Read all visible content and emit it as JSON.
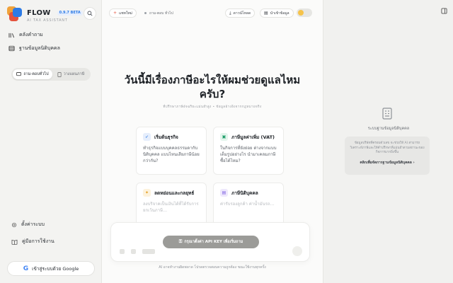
{
  "brand": {
    "name": "FLOW",
    "version": "0.9.7 BETA",
    "subtitle": "AI TAX ASSISTANT"
  },
  "sidebar": {
    "nav": [
      {
        "label": "คลังคำถาม",
        "icon": "library-icon"
      },
      {
        "label": "ฐานข้อมูลนิติบุคคล",
        "icon": "database-icon"
      }
    ],
    "segments": [
      {
        "label": "ถาม-ตอบทั่วไป",
        "icon": "chat-icon",
        "active": true
      },
      {
        "label": "วางแผนภาษี",
        "icon": "document-icon",
        "active": false
      }
    ],
    "settings_label": "ตั้งค่าระบบ",
    "guide_label": "คู่มือการใช้งาน",
    "google_login_label": "เข้าสู่ระบบด้วย Google"
  },
  "topbar": {
    "new_chat_label": "แชทใหม่",
    "mode_label": "ถาม-ตอบ ทั่วไป",
    "download_label": "ดาวน์โหลด",
    "company_label": "นำเข้าข้อมูล"
  },
  "main": {
    "headline": "วันนี้มีเรื่องภาษีอะไรให้ผมช่วยดูแลไหมครับ?",
    "subline": "ที่ปรึกษาภาษีอัจฉริยะแม่นยำสูง • ข้อมูลอ้างอิงจากกฎหมายจริง"
  },
  "cards": [
    {
      "title": "เริ่มต้นธุรกิจ",
      "desc": "ทำธุรกิจแบบบุคคลธรรมดากับ นิติบุคคล แบบไหนเสียภาษีน้อยกว่ากัน?",
      "icon": "rocket-icon",
      "icon_color": "#2d7be5",
      "icon_bg": "#e6eefc",
      "glyph": "➶"
    },
    {
      "title": "ภาษีมูลค่าเพิ่ม (VAT)",
      "desc": "ในกิจการที่ยังย่อย ต่างจากแบบเต็มรูปอย่างไร นำมาเคลมภาษีซื้อได้ไหม?",
      "icon": "receipt-icon",
      "icon_color": "#1e9e6a",
      "icon_bg": "#e3f5ec",
      "glyph": "▣"
    },
    {
      "title": "ลดหย่อนและกลยุทธ์",
      "desc": "ลงบริจาคเป็นเงินได้ที่ได้รับการยกเว้นภาษี…",
      "icon": "lightbulb-icon",
      "icon_color": "#e39a16",
      "icon_bg": "#fdf2dc",
      "glyph": "✦"
    },
    {
      "title": "ภาษีนิติบุคคล",
      "desc": "ค่ารับรองลูกค้า ค่าน้ำมันรถ…",
      "icon": "building-icon",
      "icon_color": "#7a5be0",
      "icon_bg": "#eee8fc",
      "glyph": "▤"
    }
  ],
  "composer": {
    "api_key_label": "กรุณาตั้งค่า API KEY เพื่อเริ่มถาม",
    "disclaimer": "AI อาจทำงานผิดพลาด โปรดตรวจสอบความถูกต้อง ขณะใช้งานทุกครั้ง"
  },
  "right_panel": {
    "title": "ระบบฐานข้อมูลนิติบุคคล",
    "desc": "ข้อมูลบริษัทที่ครอบตัวเลข จะช่วยให้ AI สามารถวิเคราะห์ภาษีและให้คำปรึกษาที่แม่นยำตามสถานะของกิจการมากยิ่งขึ้น",
    "link": "คลิกเพื่อจัดการฐานข้อมูลนิติบุคคล"
  }
}
